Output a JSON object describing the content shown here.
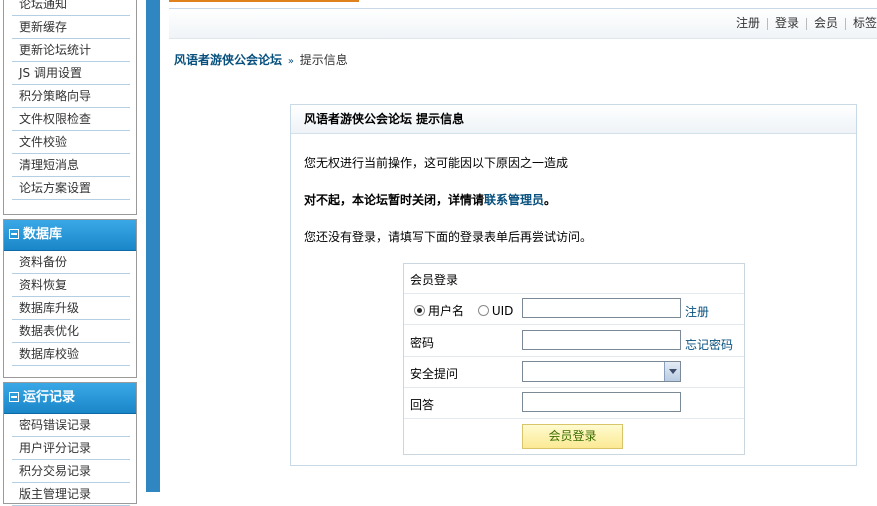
{
  "sidebar": {
    "panel1": {
      "items": [
        "论坛通知",
        "更新缓存",
        "更新论坛统计",
        "JS 调用设置",
        "积分策略向导",
        "文件权限检查",
        "文件校验",
        "清理短消息",
        "论坛方案设置"
      ]
    },
    "panel2": {
      "title": "数据库",
      "items": [
        "资料备份",
        "资料恢复",
        "数据库升级",
        "数据表优化",
        "数据库校验"
      ]
    },
    "panel3": {
      "title": "运行记录",
      "items": [
        "密码错误记录",
        "用户评分记录",
        "积分交易记录",
        "版主管理记录"
      ]
    }
  },
  "nav": {
    "links": [
      "注册",
      "登录",
      "会员",
      "标签"
    ]
  },
  "breadcrumb": {
    "forum": "风语者游侠公会论坛",
    "arrow": "»",
    "current": "提示信息"
  },
  "message": {
    "title": "风语者游侠公会论坛  提示信息",
    "line1": "您无权进行当前操作，这可能因以下原因之一造成",
    "line2_prefix": "对不起，本论坛暂时关闭，详情请",
    "line2_link": "联系管理员",
    "line2_suffix": "。",
    "line3": "您还没有登录，请填写下面的登录表单后再尝试访问。"
  },
  "login": {
    "header": "会员登录",
    "radio_username": "用户名",
    "radio_uid": "UID",
    "selected_radio": "username",
    "register_link": "注册",
    "password_label": "密码",
    "forgot_link": "忘记密码",
    "question_label": "安全提问",
    "question_value": "",
    "answer_label": "回答",
    "submit_label": "会员登录"
  },
  "colors": {
    "sidebar_header": "#1a86c9",
    "link": "#07507e",
    "submit_bg": "#fbe994",
    "accent_orange": "#e0821c"
  }
}
